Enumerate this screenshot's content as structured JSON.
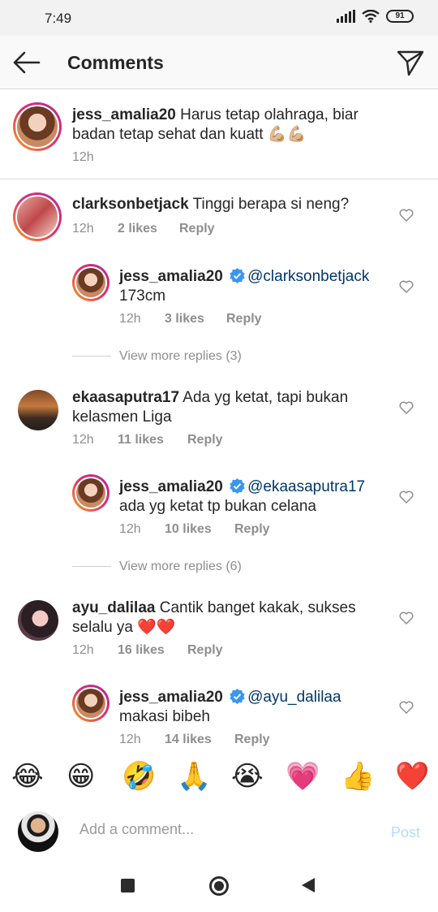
{
  "status": {
    "time": "7:49",
    "battery": "91"
  },
  "header": {
    "title": "Comments"
  },
  "caption": {
    "user": "jess_amalia20",
    "text": "Harus tetap olahraga, biar badan tetap sehat dan kuatt 💪🏼💪🏼",
    "time": "12h"
  },
  "comments": [
    {
      "user": "clarksonbetjack",
      "text": "Tinggi berapa si neng?",
      "time": "12h",
      "likes": "2 likes",
      "reply": "Reply"
    },
    {
      "user": "jess_amalia20",
      "mention": "@clarksonbetjack",
      "text": "173cm",
      "time": "12h",
      "likes": "3 likes",
      "reply": "Reply"
    },
    {
      "more": "View more replies (3)"
    },
    {
      "user": "ekaasaputra17",
      "text": "Ada yg ketat, tapi bukan kelasmen Liga",
      "time": "12h",
      "likes": "11 likes",
      "reply": "Reply"
    },
    {
      "user": "jess_amalia20",
      "mention": "@ekaasaputra17",
      "text": "ada yg ketat tp bukan celana",
      "time": "12h",
      "likes": "10 likes",
      "reply": "Reply"
    },
    {
      "more": "View more replies (6)"
    },
    {
      "user": "ayu_dalilaa",
      "text": "Cantik banget kakak, sukses selalu ya ❤️❤️",
      "time": "12h",
      "likes": "16 likes",
      "reply": "Reply"
    },
    {
      "user": "jess_amalia20",
      "mention": "@ayu_dalilaa",
      "text": "makasi bibeh",
      "time": "12h",
      "likes": "14 likes",
      "reply": "Reply"
    }
  ],
  "emojis": [
    "😂",
    "😁",
    "🤣",
    "🙏",
    "😭",
    "💗",
    "👍",
    "❤️"
  ],
  "composer": {
    "placeholder": "Add a comment...",
    "post_label": "Post"
  },
  "colors": {
    "accent": "#0095f6",
    "post_disabled": "#b3dbff",
    "mention": "#00376b"
  }
}
